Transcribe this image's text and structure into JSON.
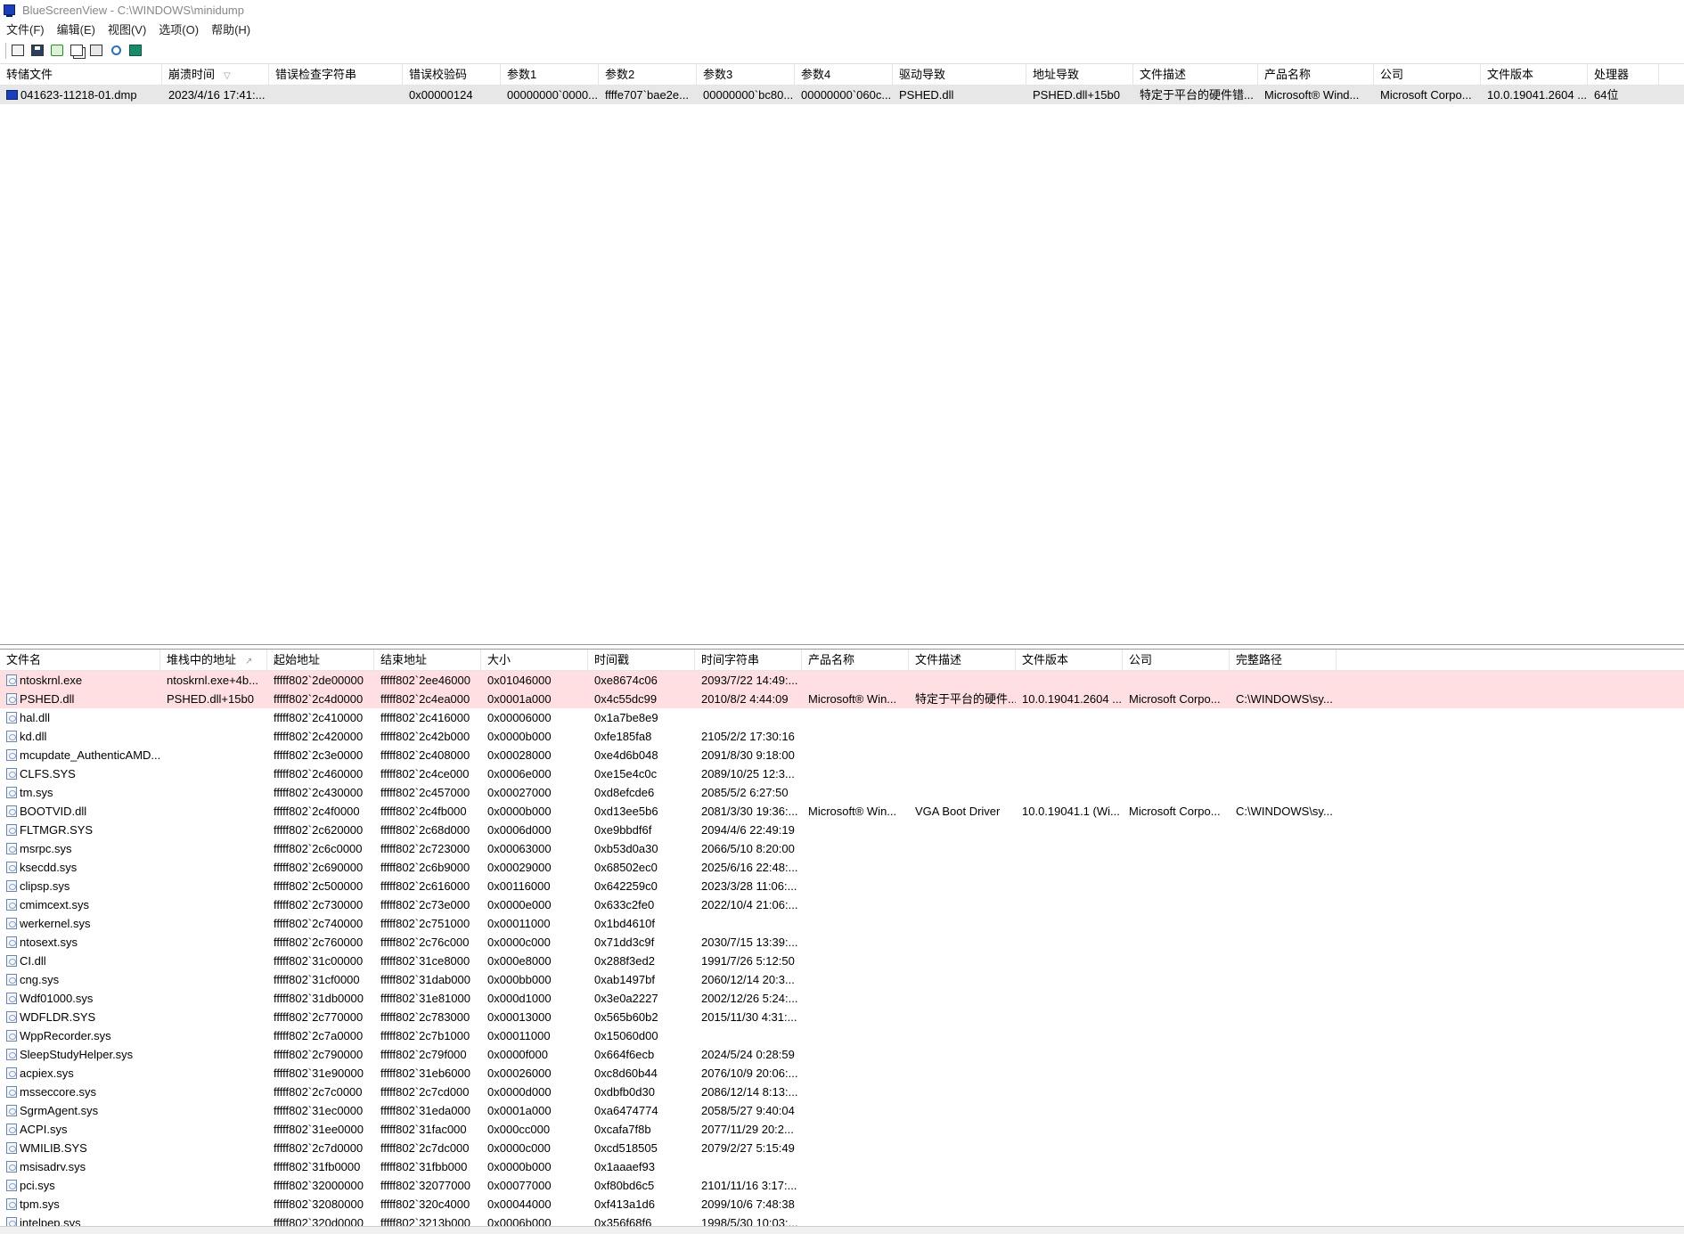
{
  "window": {
    "title": "BlueScreenView  -  C:\\WINDOWS\\minidump"
  },
  "menu": [
    "文件(F)",
    "编辑(E)",
    "视图(V)",
    "选项(O)",
    "帮助(H)"
  ],
  "toolbar": [
    "properties-icon",
    "save-icon",
    "refresh-icon",
    "copy-icon",
    "html-report-icon",
    "find-icon",
    "exit-icon"
  ],
  "dumps": {
    "columns": [
      "转储文件",
      "崩溃时间",
      "错误检查字符串",
      "错误校验码",
      "参数1",
      "参数2",
      "参数3",
      "参数4",
      "驱动导致",
      "地址导致",
      "文件描述",
      "产品名称",
      "公司",
      "文件版本",
      "处理器"
    ],
    "sort_indicator": "▽",
    "rows": [
      [
        "041623-11218-01.dmp",
        "2023/4/16 17:41:...",
        "",
        "0x00000124",
        "00000000`0000...",
        "ffffe707`bae2e...",
        "00000000`bc80...",
        "00000000`060c...",
        "PSHED.dll",
        "PSHED.dll+15b0",
        "特定于平台的硬件错...",
        "Microsoft® Wind...",
        "Microsoft Corpo...",
        "10.0.19041.2604 ...",
        "64位"
      ]
    ]
  },
  "drivers": {
    "columns": [
      "文件名",
      "堆栈中的地址",
      "起始地址",
      "结束地址",
      "大小",
      "时间戳",
      "时间字符串",
      "产品名称",
      "文件描述",
      "文件版本",
      "公司",
      "完整路径"
    ],
    "sort_indicator": "↗",
    "rows": [
      [
        "ntoskrnl.exe",
        "ntoskrnl.exe+4b...",
        "fffff802`2de00000",
        "fffff802`2ee46000",
        "0x01046000",
        "0xe8674c06",
        "2093/7/22 14:49:...",
        "",
        "",
        "",
        "",
        ""
      ],
      [
        "PSHED.dll",
        "PSHED.dll+15b0",
        "fffff802`2c4d0000",
        "fffff802`2c4ea000",
        "0x0001a000",
        "0x4c55dc99",
        "2010/8/2 4:44:09",
        "Microsoft® Win...",
        "特定于平台的硬件...",
        "10.0.19041.2604 ...",
        "Microsoft Corpo...",
        "C:\\WINDOWS\\sy..."
      ],
      [
        "hal.dll",
        "",
        "fffff802`2c410000",
        "fffff802`2c416000",
        "0x00006000",
        "0x1a7be8e9",
        "",
        "",
        "",
        "",
        "",
        ""
      ],
      [
        "kd.dll",
        "",
        "fffff802`2c420000",
        "fffff802`2c42b000",
        "0x0000b000",
        "0xfe185fa8",
        "2105/2/2 17:30:16",
        "",
        "",
        "",
        "",
        ""
      ],
      [
        "mcupdate_AuthenticAMD...",
        "",
        "fffff802`2c3e0000",
        "fffff802`2c408000",
        "0x00028000",
        "0xe4d6b048",
        "2091/8/30 9:18:00",
        "",
        "",
        "",
        "",
        ""
      ],
      [
        "CLFS.SYS",
        "",
        "fffff802`2c460000",
        "fffff802`2c4ce000",
        "0x0006e000",
        "0xe15e4c0c",
        "2089/10/25 12:3...",
        "",
        "",
        "",
        "",
        ""
      ],
      [
        "tm.sys",
        "",
        "fffff802`2c430000",
        "fffff802`2c457000",
        "0x00027000",
        "0xd8efcde6",
        "2085/5/2 6:27:50",
        "",
        "",
        "",
        "",
        ""
      ],
      [
        "BOOTVID.dll",
        "",
        "fffff802`2c4f0000",
        "fffff802`2c4fb000",
        "0x0000b000",
        "0xd13ee5b6",
        "2081/3/30 19:36:...",
        "Microsoft® Win...",
        "VGA Boot Driver",
        "10.0.19041.1 (Wi...",
        "Microsoft Corpo...",
        "C:\\WINDOWS\\sy..."
      ],
      [
        "FLTMGR.SYS",
        "",
        "fffff802`2c620000",
        "fffff802`2c68d000",
        "0x0006d000",
        "0xe9bbdf6f",
        "2094/4/6 22:49:19",
        "",
        "",
        "",
        "",
        ""
      ],
      [
        "msrpc.sys",
        "",
        "fffff802`2c6c0000",
        "fffff802`2c723000",
        "0x00063000",
        "0xb53d0a30",
        "2066/5/10 8:20:00",
        "",
        "",
        "",
        "",
        ""
      ],
      [
        "ksecdd.sys",
        "",
        "fffff802`2c690000",
        "fffff802`2c6b9000",
        "0x00029000",
        "0x68502ec0",
        "2025/6/16 22:48:...",
        "",
        "",
        "",
        "",
        ""
      ],
      [
        "clipsp.sys",
        "",
        "fffff802`2c500000",
        "fffff802`2c616000",
        "0x00116000",
        "0x642259c0",
        "2023/3/28 11:06:...",
        "",
        "",
        "",
        "",
        ""
      ],
      [
        "cmimcext.sys",
        "",
        "fffff802`2c730000",
        "fffff802`2c73e000",
        "0x0000e000",
        "0x633c2fe0",
        "2022/10/4 21:06:...",
        "",
        "",
        "",
        "",
        ""
      ],
      [
        "werkernel.sys",
        "",
        "fffff802`2c740000",
        "fffff802`2c751000",
        "0x00011000",
        "0x1bd4610f",
        "",
        "",
        "",
        "",
        "",
        ""
      ],
      [
        "ntosext.sys",
        "",
        "fffff802`2c760000",
        "fffff802`2c76c000",
        "0x0000c000",
        "0x71dd3c9f",
        "2030/7/15 13:39:...",
        "",
        "",
        "",
        "",
        ""
      ],
      [
        "CI.dll",
        "",
        "fffff802`31c00000",
        "fffff802`31ce8000",
        "0x000e8000",
        "0x288f3ed2",
        "1991/7/26 5:12:50",
        "",
        "",
        "",
        "",
        ""
      ],
      [
        "cng.sys",
        "",
        "fffff802`31cf0000",
        "fffff802`31dab000",
        "0x000bb000",
        "0xab1497bf",
        "2060/12/14 20:3...",
        "",
        "",
        "",
        "",
        ""
      ],
      [
        "Wdf01000.sys",
        "",
        "fffff802`31db0000",
        "fffff802`31e81000",
        "0x000d1000",
        "0x3e0a2227",
        "2002/12/26 5:24:...",
        "",
        "",
        "",
        "",
        ""
      ],
      [
        "WDFLDR.SYS",
        "",
        "fffff802`2c770000",
        "fffff802`2c783000",
        "0x00013000",
        "0x565b60b2",
        "2015/11/30 4:31:...",
        "",
        "",
        "",
        "",
        ""
      ],
      [
        "WppRecorder.sys",
        "",
        "fffff802`2c7a0000",
        "fffff802`2c7b1000",
        "0x00011000",
        "0x15060d00",
        "",
        "",
        "",
        "",
        "",
        ""
      ],
      [
        "SleepStudyHelper.sys",
        "",
        "fffff802`2c790000",
        "fffff802`2c79f000",
        "0x0000f000",
        "0x664f6ecb",
        "2024/5/24 0:28:59",
        "",
        "",
        "",
        "",
        ""
      ],
      [
        "acpiex.sys",
        "",
        "fffff802`31e90000",
        "fffff802`31eb6000",
        "0x00026000",
        "0xc8d60b44",
        "2076/10/9 20:06:...",
        "",
        "",
        "",
        "",
        ""
      ],
      [
        "msseccore.sys",
        "",
        "fffff802`2c7c0000",
        "fffff802`2c7cd000",
        "0x0000d000",
        "0xdbfb0d30",
        "2086/12/14 8:13:...",
        "",
        "",
        "",
        "",
        ""
      ],
      [
        "SgrmAgent.sys",
        "",
        "fffff802`31ec0000",
        "fffff802`31eda000",
        "0x0001a000",
        "0xa6474774",
        "2058/5/27 9:40:04",
        "",
        "",
        "",
        "",
        ""
      ],
      [
        "ACPI.sys",
        "",
        "fffff802`31ee0000",
        "fffff802`31fac000",
        "0x000cc000",
        "0xcafa7f8b",
        "2077/11/29 20:2...",
        "",
        "",
        "",
        "",
        ""
      ],
      [
        "WMILIB.SYS",
        "",
        "fffff802`2c7d0000",
        "fffff802`2c7dc000",
        "0x0000c000",
        "0xcd518505",
        "2079/2/27 5:15:49",
        "",
        "",
        "",
        "",
        ""
      ],
      [
        "msisadrv.sys",
        "",
        "fffff802`31fb0000",
        "fffff802`31fbb000",
        "0x0000b000",
        "0x1aaaef93",
        "",
        "",
        "",
        "",
        "",
        ""
      ],
      [
        "pci.sys",
        "",
        "fffff802`32000000",
        "fffff802`32077000",
        "0x00077000",
        "0xf80bd6c5",
        "2101/11/16 3:17:...",
        "",
        "",
        "",
        "",
        ""
      ],
      [
        "tpm.sys",
        "",
        "fffff802`32080000",
        "fffff802`320c4000",
        "0x00044000",
        "0xf413a1d6",
        "2099/10/6 7:48:38",
        "",
        "",
        "",
        "",
        ""
      ],
      [
        "intelpep.sys",
        "",
        "fffff802`320d0000",
        "fffff802`3213b000",
        "0x0006b000",
        "0x356f68f6",
        "1998/5/30 10:03:...",
        "",
        "",
        "",
        "",
        ""
      ]
    ]
  }
}
